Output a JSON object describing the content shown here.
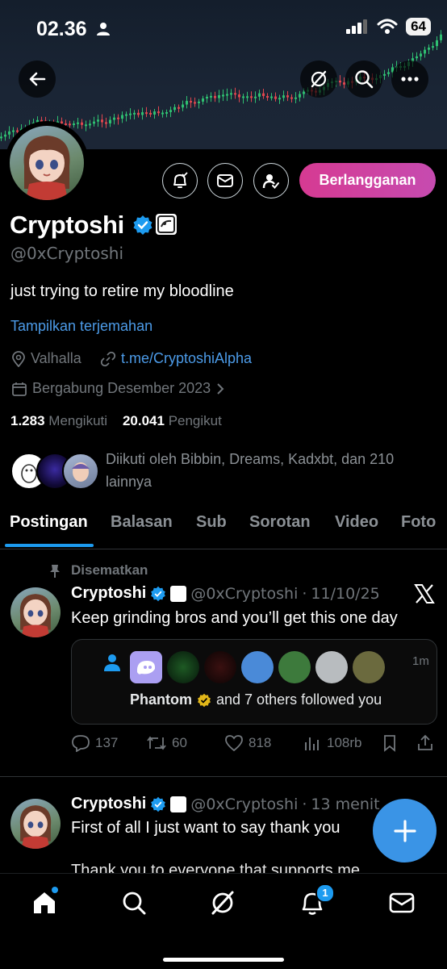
{
  "status": {
    "time": "02.36",
    "battery": "64"
  },
  "profile": {
    "name": "Cryptoshi",
    "handle": "@0xCryptoshi",
    "bio": "just trying to retire my bloodline",
    "translate": "Tampilkan terjemahan",
    "location": "Valhalla",
    "link": "t.me/CryptoshiAlpha",
    "joined": "Bergabung Desember 2023",
    "following_count": "1.283",
    "following_label": "Mengikuti",
    "followers_count": "20.041",
    "followers_label": "Pengikut",
    "followed_by": "Diikuti oleh Bibbin, Dreams, Kadxbt, dan 210 lainnya",
    "subscribe_label": "Berlangganan"
  },
  "tabs": [
    "Postingan",
    "Balasan",
    "Sub",
    "Sorotan",
    "Video",
    "Foto"
  ],
  "posts": [
    {
      "pinned_label": "Disematkan",
      "name": "Cryptoshi",
      "handle": "@0xCryptoshi",
      "time": "11/10/25",
      "text": "Keep grinding bros and you’ll get this one day",
      "card": {
        "title": "Phantom",
        "rest": "and 7 others followed you",
        "age": "1m"
      },
      "replies": "137",
      "reposts": "60",
      "likes": "818",
      "views": "108rb"
    },
    {
      "name": "Cryptoshi",
      "handle": "@0xCryptoshi",
      "time": "13 menit",
      "line1": "First of all I just want to say thank you",
      "line2": "Thank you to everyone that supports me"
    }
  ],
  "notifications_badge": "1",
  "colors": {
    "accent": "#1d9bf0",
    "subscribe_start": "#d63a92",
    "subscribe_end": "#c64bb0",
    "verified": "#1d9bf0"
  }
}
